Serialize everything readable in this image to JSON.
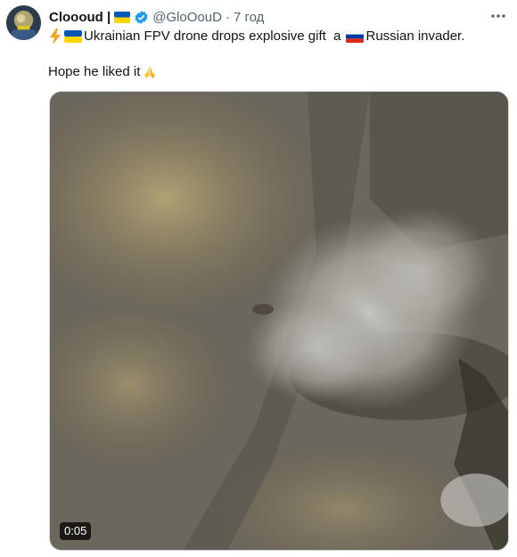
{
  "tweet": {
    "display_name": "Cloooud |",
    "handle": "@GloOouD",
    "separator": "·",
    "time": "7 год",
    "more_icon": "more-horizontal-icon",
    "text_line1_a": "Ukrainian FPV drone drops explosive gift  a",
    "text_line1_b": "Russian invader.",
    "text_line2": "Hope he liked it",
    "video": {
      "duration": "0:05"
    }
  },
  "colors": {
    "text": "#0f1419",
    "muted": "#536471",
    "verified": "#1d9bf0",
    "ua_blue": "#0057b7",
    "ua_yellow": "#ffd700"
  }
}
